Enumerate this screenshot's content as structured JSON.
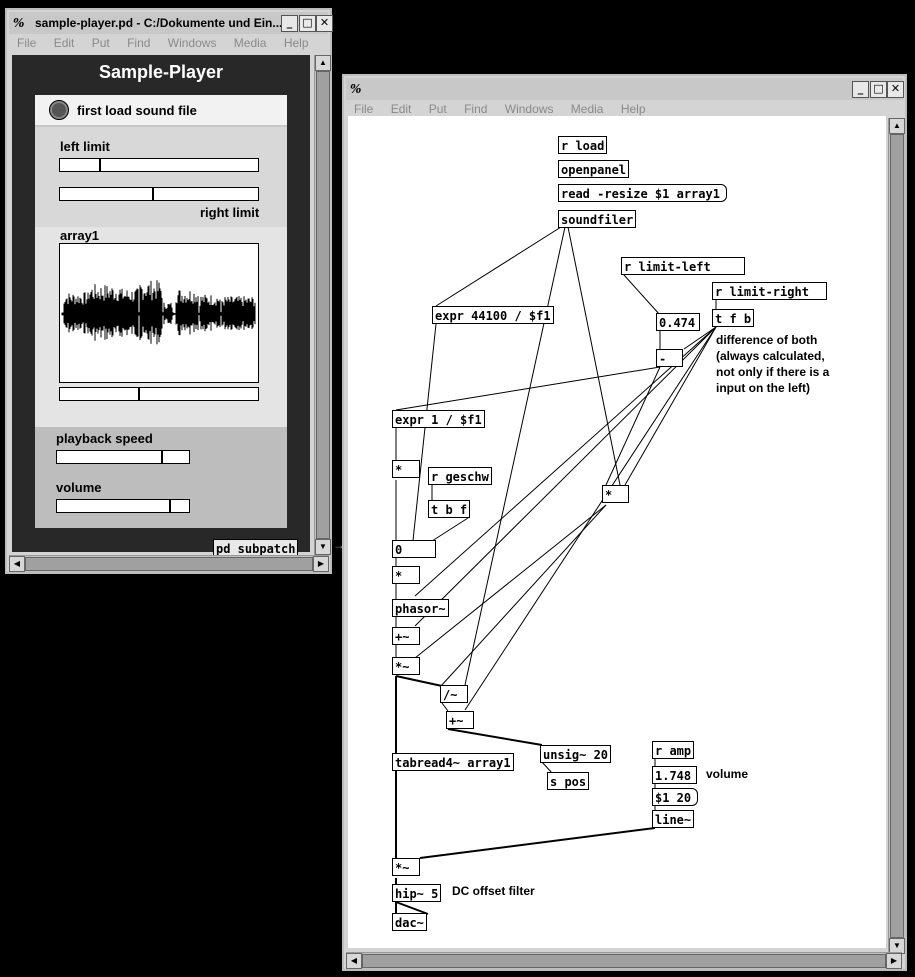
{
  "left_window": {
    "title": "sample-player.pd  - C:/Dokumente und Ein...",
    "logo": "%",
    "menu": [
      "File",
      "Edit",
      "Put",
      "Find",
      "Windows",
      "Media",
      "Help"
    ],
    "panel": {
      "heading": "Sample-Player",
      "load_label": "first load sound file",
      "left_limit_label": "left limit",
      "right_limit_label": "right limit",
      "array_label": "array1",
      "playback_speed_label": "playback speed",
      "volume_label": "volume",
      "left_limit_value": 0.2,
      "right_limit_value": 0.47,
      "array_slider_value": 0.4,
      "playback_speed_value": 0.8,
      "volume_value": 0.86
    },
    "subpatch_label": "pd subpatch"
  },
  "right_window": {
    "logo": "%",
    "menu": [
      "File",
      "Edit",
      "Put",
      "Find",
      "Windows",
      "Media",
      "Help"
    ],
    "objects": {
      "r_load": "r load",
      "openpanel": "openpanel",
      "read_resize": "read -resize $1 array1",
      "soundfiler": "soundfiler",
      "r_limit_left": "r limit-left",
      "r_limit_right": "r limit-right",
      "expr_44100": "expr 44100 / $f1",
      "num_0474": "0.474",
      "t_f_b": "t f b",
      "minus": "-",
      "expr_1": "expr 1 / $f1",
      "mult1": "*",
      "r_geschw": "r geschw",
      "t_b_f": "t b f",
      "mult_right": "*",
      "num_0": "0",
      "mult2": "*",
      "phasor": "phasor~",
      "plus_tilde": "+~",
      "mult_tilde": "*~",
      "div_tilde": "/~",
      "plus_tilde2": "+~",
      "unsig": "unsig~ 20",
      "s_pos": "s pos",
      "tabread": "tabread4~ array1",
      "r_amp": "r amp",
      "num_1748": "1.748",
      "msg_1_20": "$1 20",
      "line_tilde": "line~",
      "mult_tilde_out": "*~",
      "hip": "hip~ 5",
      "dac": "dac~"
    },
    "comments": {
      "difference_1": "difference of both",
      "difference_2": "(always calculated,",
      "difference_3": "not only if there is a",
      "difference_4": "input on the left)",
      "volume": "volume",
      "dc_offset": "DC offset filter"
    }
  }
}
